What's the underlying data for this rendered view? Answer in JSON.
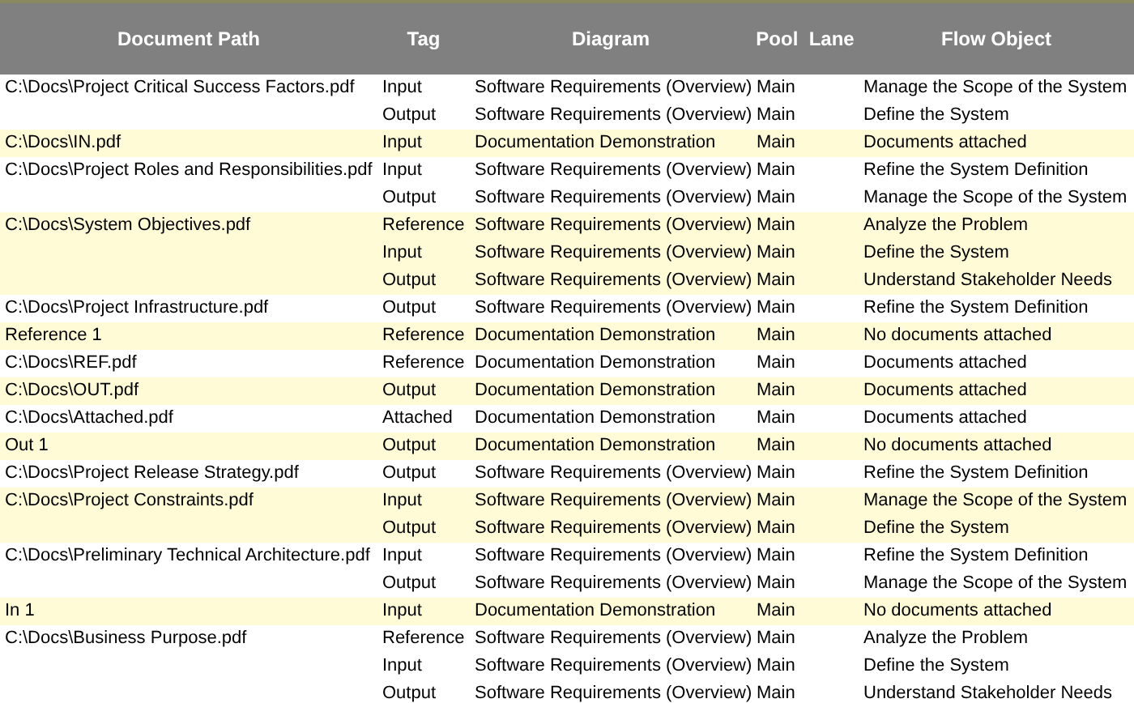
{
  "table": {
    "columns": [
      "Document Path",
      "Tag",
      "Diagram",
      "Pool  Lane",
      "Flow Object"
    ],
    "documents": [
      {
        "path": "C:\\Docs\\Project Critical Success Factors.pdf",
        "links": [
          {
            "tag": "Input",
            "diagram": "Software Requirements (Overview)",
            "pool_lane": "Main",
            "flow_object": "Manage the Scope of the System"
          },
          {
            "tag": "Output",
            "diagram": "Software Requirements (Overview)",
            "pool_lane": "Main",
            "flow_object": "Define the System"
          }
        ]
      },
      {
        "path": "C:\\Docs\\IN.pdf",
        "links": [
          {
            "tag": "Input",
            "diagram": "Documentation Demonstration",
            "pool_lane": "Main",
            "flow_object": "Documents attached"
          }
        ]
      },
      {
        "path": "C:\\Docs\\Project Roles and Responsibilities.pdf",
        "links": [
          {
            "tag": "Input",
            "diagram": "Software Requirements (Overview)",
            "pool_lane": "Main",
            "flow_object": "Refine the System Definition"
          },
          {
            "tag": "Output",
            "diagram": "Software Requirements (Overview)",
            "pool_lane": "Main",
            "flow_object": "Manage the Scope of the System"
          }
        ]
      },
      {
        "path": "C:\\Docs\\System Objectives.pdf",
        "links": [
          {
            "tag": "Reference",
            "diagram": "Software Requirements (Overview)",
            "pool_lane": "Main",
            "flow_object": "Analyze the Problem"
          },
          {
            "tag": "Input",
            "diagram": "Software Requirements (Overview)",
            "pool_lane": "Main",
            "flow_object": "Define the System"
          },
          {
            "tag": "Output",
            "diagram": "Software Requirements (Overview)",
            "pool_lane": "Main",
            "flow_object": "Understand Stakeholder Needs"
          }
        ]
      },
      {
        "path": "C:\\Docs\\Project Infrastructure.pdf",
        "links": [
          {
            "tag": "Output",
            "diagram": "Software Requirements (Overview)",
            "pool_lane": "Main",
            "flow_object": "Refine the System Definition"
          }
        ]
      },
      {
        "path": "Reference 1",
        "links": [
          {
            "tag": "Reference",
            "diagram": "Documentation Demonstration",
            "pool_lane": "Main",
            "flow_object": "No documents attached"
          }
        ]
      },
      {
        "path": "C:\\Docs\\REF.pdf",
        "links": [
          {
            "tag": "Reference",
            "diagram": "Documentation Demonstration",
            "pool_lane": "Main",
            "flow_object": "Documents attached"
          }
        ]
      },
      {
        "path": "C:\\Docs\\OUT.pdf",
        "links": [
          {
            "tag": "Output",
            "diagram": "Documentation Demonstration",
            "pool_lane": "Main",
            "flow_object": "Documents attached"
          }
        ]
      },
      {
        "path": "C:\\Docs\\Attached.pdf",
        "links": [
          {
            "tag": "Attached",
            "diagram": "Documentation Demonstration",
            "pool_lane": "Main",
            "flow_object": "Documents attached"
          }
        ]
      },
      {
        "path": "Out 1",
        "links": [
          {
            "tag": "Output",
            "diagram": "Documentation Demonstration",
            "pool_lane": "Main",
            "flow_object": "No documents attached"
          }
        ]
      },
      {
        "path": "C:\\Docs\\Project Release Strategy.pdf",
        "links": [
          {
            "tag": "Output",
            "diagram": "Software Requirements (Overview)",
            "pool_lane": "Main",
            "flow_object": "Refine the System Definition"
          }
        ]
      },
      {
        "path": "C:\\Docs\\Project Constraints.pdf",
        "links": [
          {
            "tag": "Input",
            "diagram": "Software Requirements (Overview)",
            "pool_lane": "Main",
            "flow_object": "Manage the Scope of the System"
          },
          {
            "tag": "Output",
            "diagram": "Software Requirements (Overview)",
            "pool_lane": "Main",
            "flow_object": "Define the System"
          }
        ]
      },
      {
        "path": "C:\\Docs\\Preliminary Technical Architecture.pdf",
        "links": [
          {
            "tag": "Input",
            "diagram": "Software Requirements (Overview)",
            "pool_lane": "Main",
            "flow_object": "Refine the System Definition"
          },
          {
            "tag": "Output",
            "diagram": "Software Requirements (Overview)",
            "pool_lane": "Main",
            "flow_object": "Manage the Scope of the System"
          }
        ]
      },
      {
        "path": "In 1",
        "links": [
          {
            "tag": "Input",
            "diagram": "Documentation Demonstration",
            "pool_lane": "Main",
            "flow_object": "No documents attached"
          }
        ]
      },
      {
        "path": "C:\\Docs\\Business Purpose.pdf",
        "links": [
          {
            "tag": "Reference",
            "diagram": "Software Requirements (Overview)",
            "pool_lane": "Main",
            "flow_object": "Analyze the Problem"
          },
          {
            "tag": "Input",
            "diagram": "Software Requirements (Overview)",
            "pool_lane": "Main",
            "flow_object": "Define the System"
          },
          {
            "tag": "Output",
            "diagram": "Software Requirements (Overview)",
            "pool_lane": "Main",
            "flow_object": "Understand Stakeholder Needs"
          }
        ]
      }
    ]
  }
}
